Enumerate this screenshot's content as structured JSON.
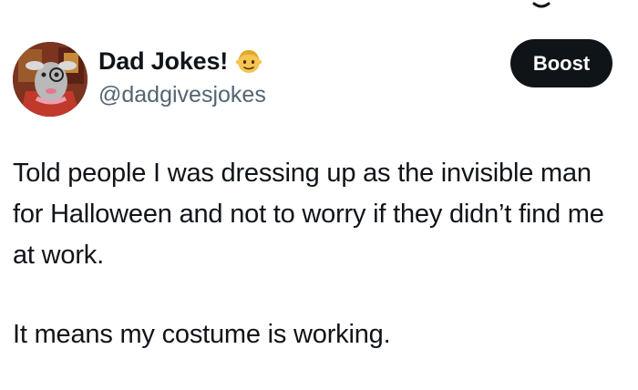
{
  "post": {
    "author": {
      "display_name": "Dad Jokes!",
      "handle": "@dadgivesjokes",
      "avatar_icon": "cartoon-goat-avatar",
      "badge_icon": "man-face-emoji-icon"
    },
    "boost_label": "Boost",
    "text": {
      "paragraph_1": "Told people I was dressing up as the invisible man for Halloween and not to worry if they didn’t find me at work.",
      "paragraph_2": "It means my costume is working."
    }
  },
  "colors": {
    "text_primary": "#0f1419",
    "text_secondary": "#536471",
    "button_bg": "#0f1419",
    "button_text": "#ffffff",
    "background": "#ffffff"
  }
}
